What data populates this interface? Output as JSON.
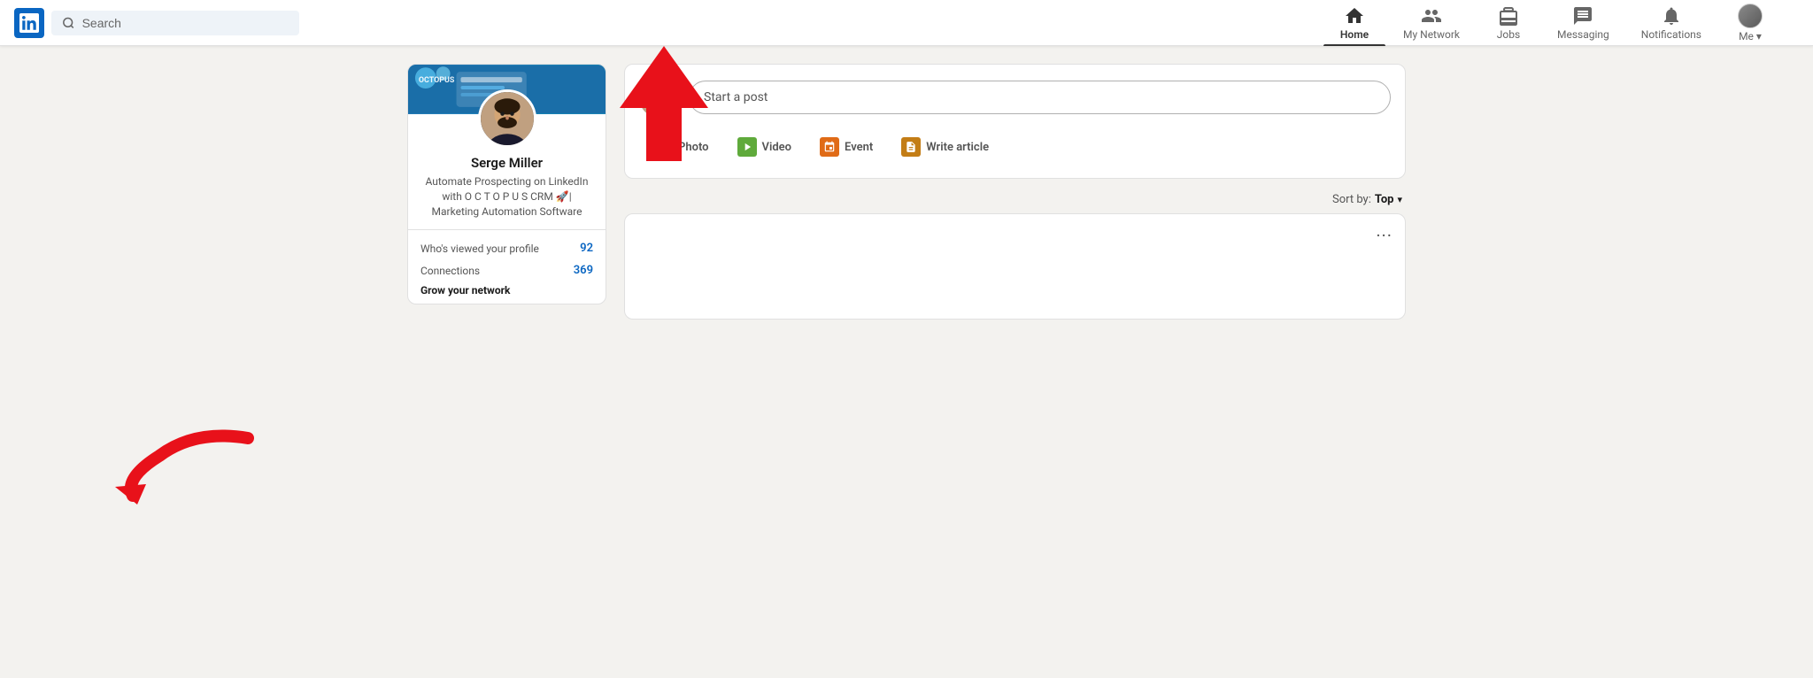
{
  "brand": {
    "logo_alt": "LinkedIn",
    "accent_color": "#0a66c2"
  },
  "navbar": {
    "search_placeholder": "Search",
    "nav_items": [
      {
        "id": "home",
        "label": "Home",
        "active": true
      },
      {
        "id": "my-network",
        "label": "My Network",
        "active": false
      },
      {
        "id": "jobs",
        "label": "Jobs",
        "active": false
      },
      {
        "id": "messaging",
        "label": "Messaging",
        "active": false
      },
      {
        "id": "notifications",
        "label": "Notifications",
        "active": false
      },
      {
        "id": "me",
        "label": "Me",
        "active": false,
        "has_dropdown": true
      }
    ]
  },
  "sidebar": {
    "profile": {
      "name": "Serge Miller",
      "headline": "Automate Prospecting on LinkedIn with O C T O P U S CRM 🚀| Marketing Automation Software"
    },
    "stats": [
      {
        "label": "Who's viewed your profile",
        "value": "92"
      },
      {
        "label": "Connections",
        "value": "369"
      },
      {
        "sub_label": "Grow your network"
      }
    ]
  },
  "feed": {
    "post_placeholder": "Start a post",
    "actions": [
      {
        "id": "photo",
        "label": "Photo"
      },
      {
        "id": "video",
        "label": "Video"
      },
      {
        "id": "event",
        "label": "Event"
      },
      {
        "id": "article",
        "label": "Write article"
      }
    ],
    "sort_label": "Sort by:",
    "sort_value": "Top",
    "post_dots": "···"
  },
  "arrows": {
    "up_arrow_label": "pointing up to Home nav",
    "left_arrow_label": "pointing left to profile stats"
  }
}
